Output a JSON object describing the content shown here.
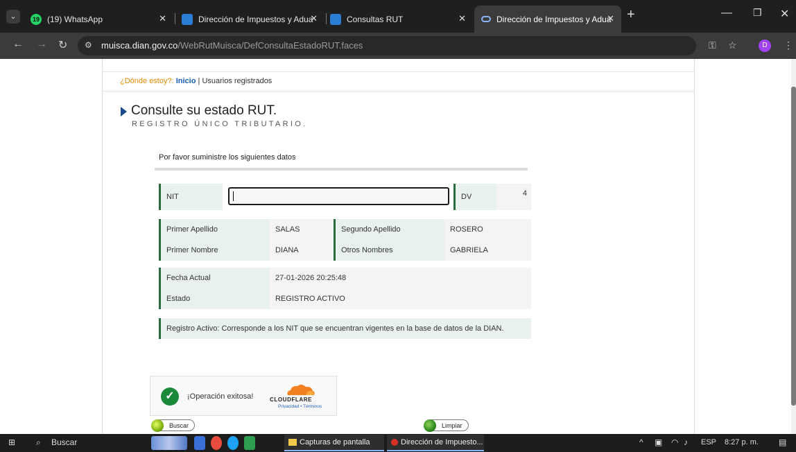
{
  "browser": {
    "tabs": [
      {
        "badge": "19",
        "title": "(19) WhatsApp"
      },
      {
        "title": "Dirección de Impuestos y Adua"
      },
      {
        "title": "Consultas RUT"
      },
      {
        "title": "Dirección de Impuestos y Adua"
      }
    ],
    "url_host": "muisca.dian.gov.co",
    "url_path": "/WebRutMuisca/DefConsultaEstadoRUT.faces",
    "profile_initial": "D"
  },
  "breadcrumb": {
    "where": "¿Dónde estoy?:",
    "home": "Inicio",
    "separator": " | ",
    "current": "Usuarios registrados"
  },
  "header": {
    "title": "Consulte su estado RUT.",
    "subtitle": "REGISTRO ÚNICO TRIBUTARIO."
  },
  "form": {
    "prompt": "Por favor suministre los siguientes datos",
    "nit_label": "NIT",
    "nit_value": "",
    "dv_label": "DV",
    "dv_value": "4"
  },
  "person": {
    "primer_apellido_label": "Primer Apellido",
    "primer_apellido": "SALAS",
    "segundo_apellido_label": "Segundo Apellido",
    "segundo_apellido": "ROSERO",
    "primer_nombre_label": "Primer Nombre",
    "primer_nombre": "DIANA",
    "otros_nombres_label": "Otros Nombres",
    "otros_nombres": "GABRIELA"
  },
  "status": {
    "fecha_label": "Fecha Actual",
    "fecha": "27-01-2026 20:25:48",
    "estado_label": "Estado",
    "estado": "REGISTRO ACTIVO",
    "note": "Registro Activo: Corresponde a los NIT que se encuentran vigentes en la base de datos de la DIAN."
  },
  "captcha": {
    "message": "¡Operación exitosa!",
    "brand": "CLOUDFLARE",
    "links": "Privacidad • Términos"
  },
  "buttons": {
    "search": "Buscar",
    "clear": "Limpiar"
  },
  "taskbar": {
    "search": "Buscar",
    "task1": "Capturas de pantalla",
    "task2": "Dirección de Impuesto...",
    "lang": "ESP",
    "time": "8:27 p. m."
  },
  "colors": {
    "label_bg": "#e9f1ec",
    "accent_green": "#2b6a3e",
    "link_blue": "#1a5fb4",
    "breadcrumb_orange": "#e08a00"
  }
}
